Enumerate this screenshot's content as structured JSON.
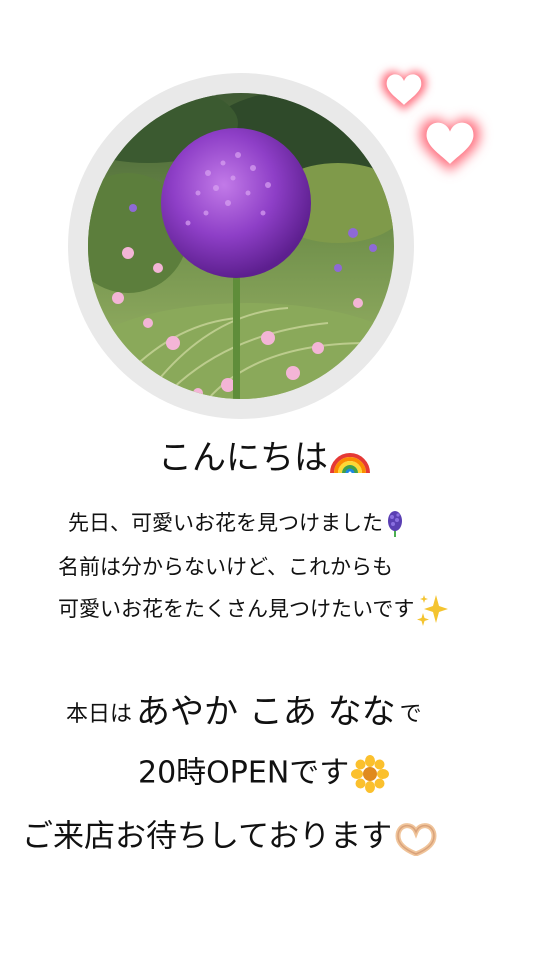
{
  "greeting": "こんにちは",
  "message": {
    "line1": "先日、可愛いお花を見つけました",
    "line2": "名前は分からないけど、これからも",
    "line3": "可愛いお花をたくさん見つけたいです"
  },
  "announcement": {
    "cast_prefix": "本日は",
    "cast_names": "あやか こあ なな",
    "cast_suffix": "で",
    "open_time": "20時OPENです",
    "welcome": "ご来店お待ちしております"
  },
  "icons": {
    "greeting": "rainbow-icon",
    "line1": "hyacinth-icon",
    "line3": "sparkles-icon",
    "open_time": "sunflower-icon",
    "welcome": "heart-hands-icon",
    "decoration": "glowing-hearts-icon"
  },
  "colors": {
    "background": "#ffffff",
    "text": "#111111",
    "photo_frame": "#e9e9e9",
    "flower": "#8e3fc7",
    "heart_glow": "#ff6f7f"
  }
}
